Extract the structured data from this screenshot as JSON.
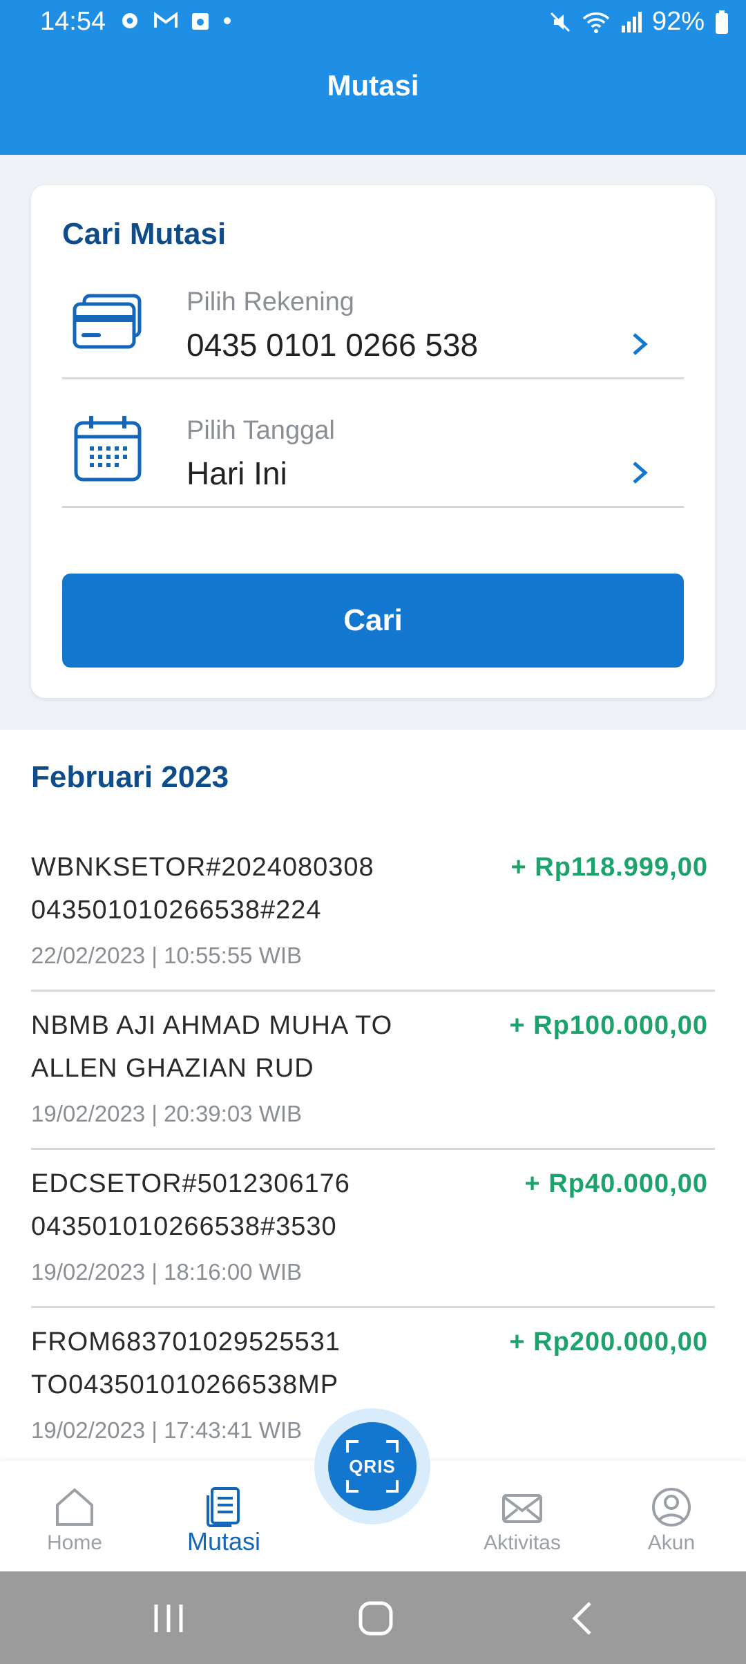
{
  "status_bar": {
    "time": "14:54",
    "battery": "92%"
  },
  "header": {
    "title": "Mutasi"
  },
  "search": {
    "title": "Cari Mutasi",
    "account": {
      "label": "Pilih Rekening",
      "value": "0435 0101 0266 538"
    },
    "date": {
      "label": "Pilih Tanggal",
      "value": "Hari Ini"
    },
    "button_label": "Cari"
  },
  "list": {
    "month": "Februari 2023",
    "transactions": [
      {
        "desc1": "WBNKSETOR#2024080308",
        "desc2": "043501010266538#224",
        "amount": "+ Rp118.999,00",
        "date": "22/02/2023 | 10:55:55 WIB"
      },
      {
        "desc1": "NBMB AJI AHMAD MUHA TO",
        "desc2": "ALLEN GHAZIAN RUD",
        "amount": "+ Rp100.000,00",
        "date": "19/02/2023 | 20:39:03 WIB"
      },
      {
        "desc1": "EDCSETOR#5012306176",
        "desc2": "043501010266538#3530",
        "amount": "+ Rp40.000,00",
        "date": "19/02/2023 | 18:16:00 WIB"
      },
      {
        "desc1": "FROM683701029525531",
        "desc2": "TO043501010266538MP",
        "amount": "+ Rp200.000,00",
        "date": "19/02/2023 | 17:43:41 WIB"
      }
    ]
  },
  "bottom_nav": {
    "items": [
      {
        "label": "Home",
        "icon": "home-icon"
      },
      {
        "label": "Mutasi",
        "icon": "document-icon"
      },
      {
        "label": "Aktivitas",
        "icon": "mail-icon"
      },
      {
        "label": "Akun",
        "icon": "user-icon"
      }
    ],
    "qris_label": "QRIS"
  },
  "colors": {
    "primary": "#1f8fe5",
    "button": "#1477cf",
    "title": "#0f4c8a",
    "credit": "#1aa36b"
  }
}
